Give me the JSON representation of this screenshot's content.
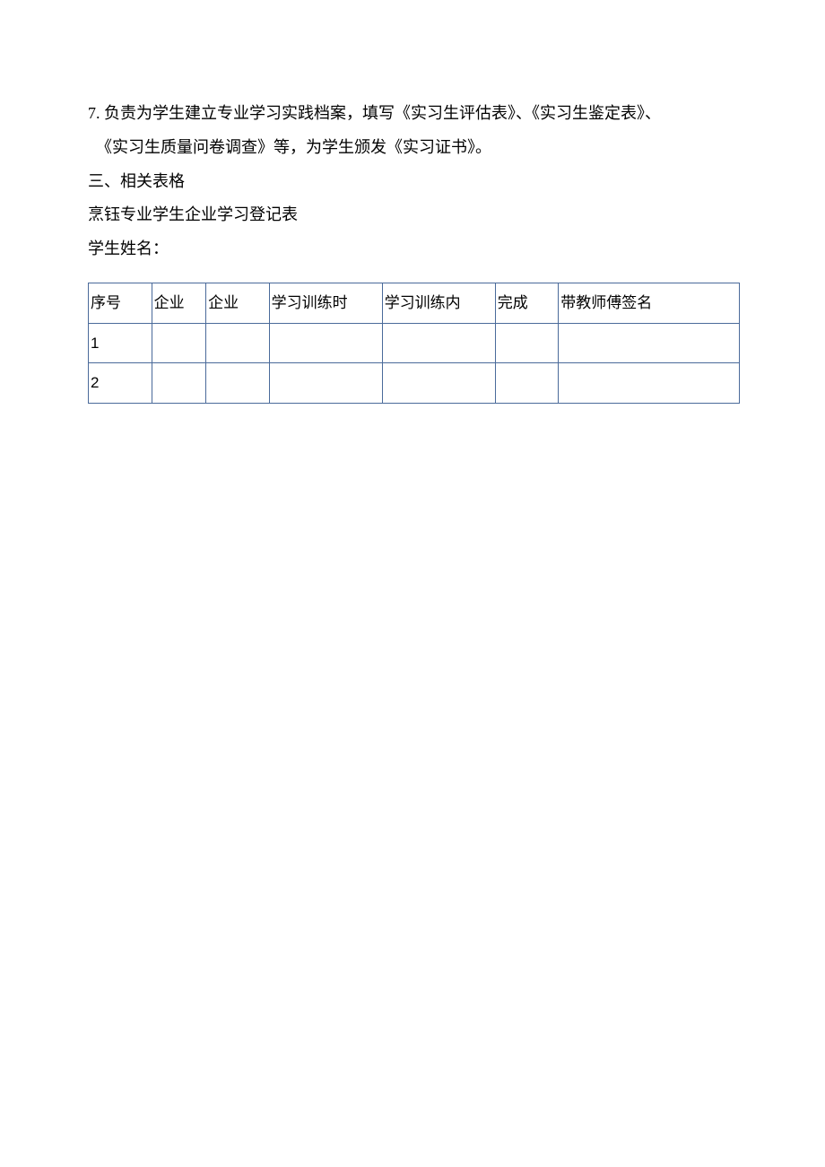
{
  "paragraphs": {
    "line1": "7. 负责为学生建立专业学习实践档案，填写《实习生评估表》、《实习生鉴定表》、",
    "line2": "《实习生质量问卷调查》等，为学生颁发《实习证书》。",
    "heading": "三、相关表格",
    "sub1": "烹钰专业学生企业学习登记表",
    "sub2": "学生姓名："
  },
  "table": {
    "headers": [
      "序号",
      "企业",
      "企业",
      "学习训练时",
      "学习训练内",
      "完成",
      "带教师傅签名"
    ],
    "rows": [
      [
        "1",
        "",
        "",
        "",
        "",
        "",
        ""
      ],
      [
        "2",
        "",
        "",
        "",
        "",
        "",
        ""
      ]
    ]
  }
}
